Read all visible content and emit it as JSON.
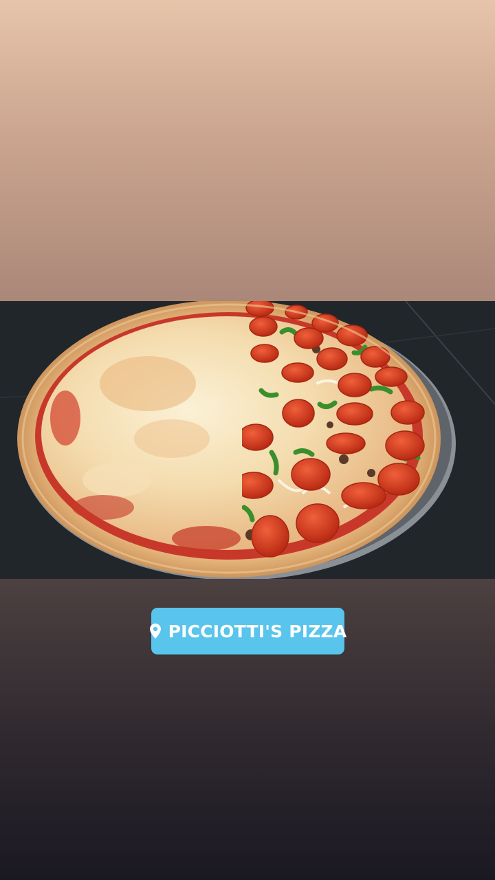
{
  "location_sticker": {
    "label": "PICCIOTTI'S PIZZA",
    "icon": "map-pin-icon",
    "background": "#59c4ec",
    "text_color": "#ffffff"
  },
  "background": {
    "top_gradient": [
      "#e6c4aa",
      "#aa8778"
    ],
    "bottom_gradient": [
      "#4d4141",
      "#1a1822"
    ]
  },
  "photo": {
    "subject": "pizza-photo",
    "halves": [
      "cheese",
      "supreme-with-pepperoni"
    ]
  }
}
